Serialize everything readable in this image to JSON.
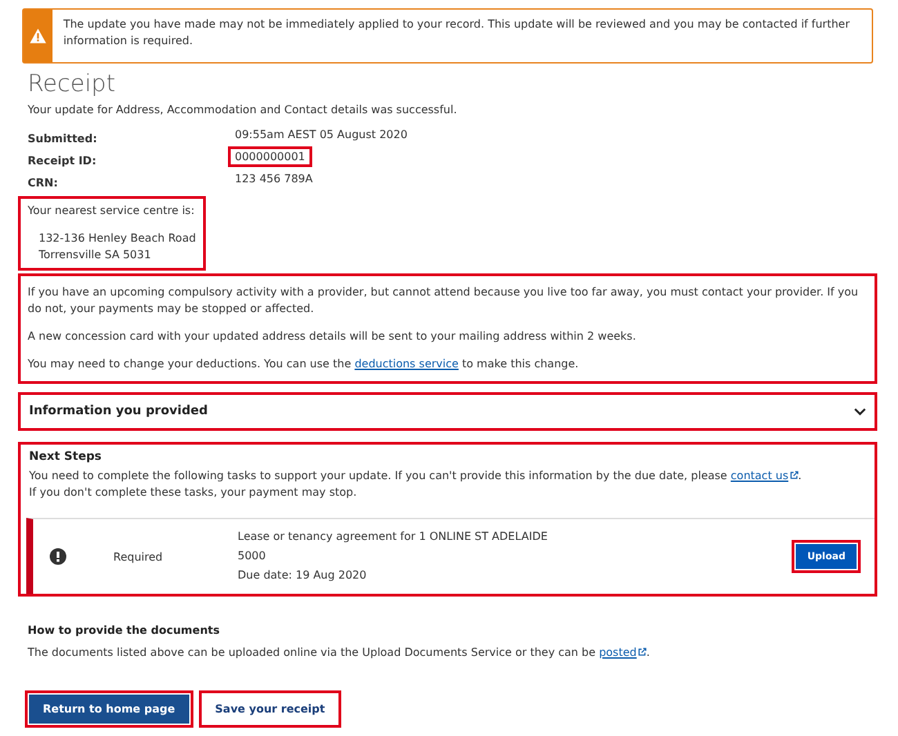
{
  "alert": {
    "text": "The update you have made may not be immediately applied to your record. This update will be reviewed and you may be contacted if further information is required."
  },
  "title": "Receipt",
  "subtitle": "Your update for Address, Accommodation and Contact details was successful.",
  "details": [
    {
      "label": "Submitted:",
      "value": "09:55am AEST 05 August 2020",
      "highlighted": false
    },
    {
      "label": "Receipt ID:",
      "value": "0000000001",
      "highlighted": true
    },
    {
      "label": "CRN:",
      "value": "123 456 789A",
      "highlighted": false
    }
  ],
  "service_centre": {
    "heading": "Your nearest service centre is:",
    "lines": [
      "132-136 Henley Beach Road",
      "Torrensville SA 5031"
    ],
    "highlighted": true
  },
  "notices": {
    "highlighted": true,
    "paragraphs": [
      {
        "text": "If you have an upcoming compulsory activity with a provider, but cannot attend because you live too far away, you must contact your provider. If you do not, your payments may be stopped or affected."
      },
      {
        "text": "A new concession card with your updated address details will be sent to your mailing address within 2 weeks."
      },
      {
        "text": "You may need to change your deductions. You can use the",
        "link": "deductions service",
        "after": "to make this change."
      }
    ]
  },
  "accordion": {
    "title": "Information you provided",
    "expanded": false,
    "highlighted": true
  },
  "next_steps": {
    "title": "Next Steps",
    "highlighted": true,
    "intro": "You need to complete the following tasks to support your update. If you can't provide this information by the due date, please",
    "link": "contact us",
    "after": ".",
    "note": "If you don't complete these tasks, your payment may stop.",
    "tasks": [
      {
        "status": "Required",
        "description": "Lease or tenancy agreement for 1 ONLINE ST ADELAIDE",
        "postcode": "5000",
        "due_label": "Due date:",
        "due": "19 Aug 2020",
        "button": "Upload",
        "highlighted": true
      }
    ]
  },
  "how_to": {
    "title": "How to provide the documents",
    "text": "The documents listed above can be uploaded online via the Upload Documents Service or they can be",
    "link": "posted",
    "after": "."
  },
  "buttons": [
    {
      "label": "Return to home page",
      "kind": "primary",
      "highlighted": true
    },
    {
      "label": "Save your receipt",
      "kind": "secondary",
      "highlighted": true
    }
  ]
}
